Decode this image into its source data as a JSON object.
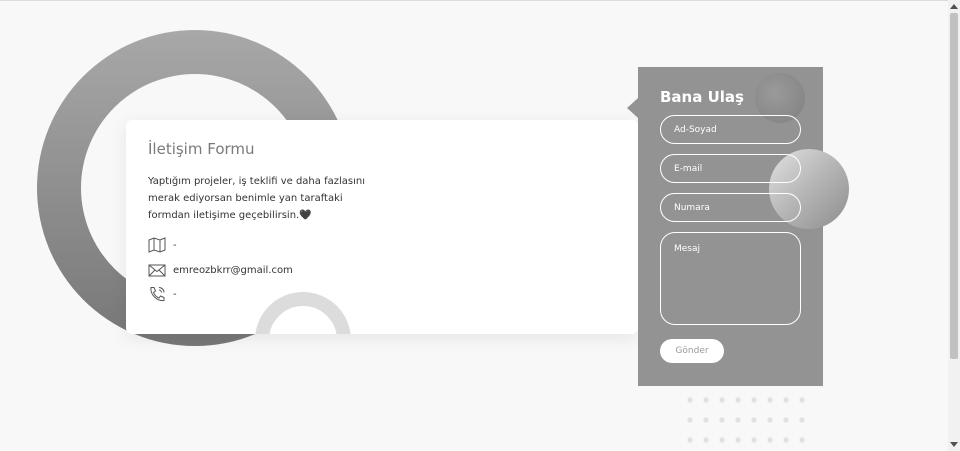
{
  "contact_card": {
    "title": "İletişim Formu",
    "description": "Yaptığım projeler, iş teklifi ve daha fazlasını merak ediyorsan benimle yan taraftaki formdan iletişime geçebilirsin.🖤",
    "address": "-",
    "email": "emreozbkrr@gmail.com",
    "phone": "-",
    "icons": [
      "map-icon",
      "mail-icon",
      "phone-icon"
    ]
  },
  "form": {
    "title": "Bana Ulaş",
    "name_placeholder": "Ad-Soyad",
    "email_placeholder": "E-mail",
    "phone_placeholder": "Numara",
    "message_placeholder": "Mesaj",
    "submit_label": "Gönder"
  },
  "colors": {
    "panel": "#939393",
    "background": "#f8f8f8",
    "card": "#ffffff"
  }
}
